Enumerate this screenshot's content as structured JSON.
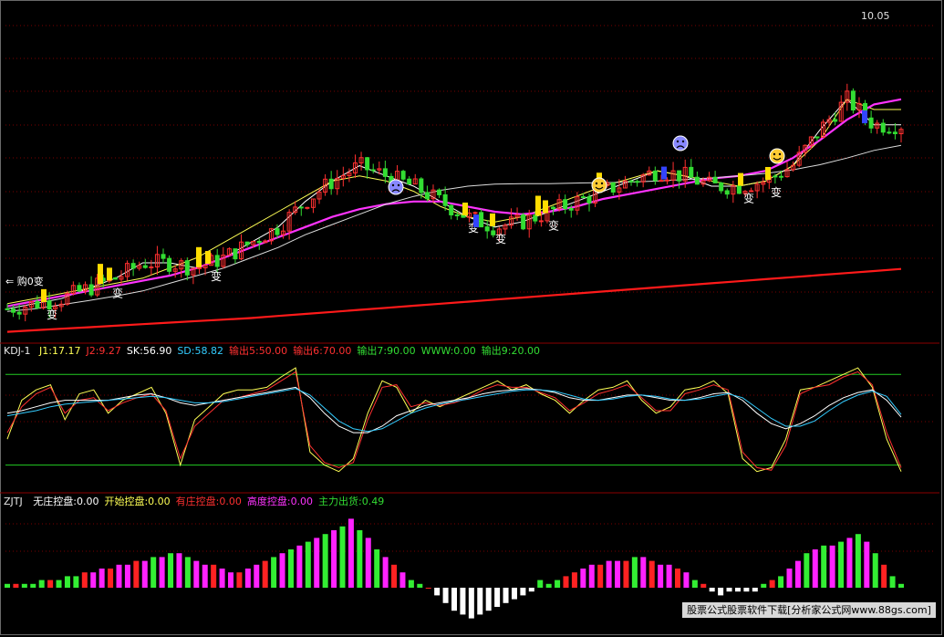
{
  "colors": {
    "background": "#000000",
    "grid": "#7a0000",
    "up_candle": "#ff3030",
    "down_candle": "#33dd33",
    "ma_fast": "#ffffff",
    "ma_mid": "#ffff55",
    "ma_magenta": "#ff33ff",
    "ma_slow": "#dddddd",
    "ma_red": "#ff1a1a",
    "kdj_j1": "#ffff55",
    "kdj_j2": "#ff3030",
    "kdj_sk": "#ffffff",
    "kdj_sd": "#33ccff",
    "bar_green": "#33ee33",
    "bar_red": "#ff2222",
    "bar_magenta": "#ff22ff",
    "bar_white": "#ffffff",
    "green_line": "#22cc22"
  },
  "price_panel": {
    "high_marker": "10.05",
    "signal_text": "变",
    "left_marker": "⇐ 购0变",
    "smiley_icons": [
      "happy-face-icon",
      "sad-face-icon"
    ]
  },
  "kdj_panel": {
    "title": "KDJ-1",
    "items": [
      {
        "label": "J1:",
        "value": "17.17",
        "color": "#ffff55"
      },
      {
        "label": "J2:",
        "value": "9.27",
        "color": "#ff3030"
      },
      {
        "label": "SK:",
        "value": "56.90",
        "color": "#ffffff"
      },
      {
        "label": "SD:",
        "value": "58.82",
        "color": "#33ccff"
      },
      {
        "label": "输出5:",
        "value": "50.00",
        "color": "#ff3030"
      },
      {
        "label": "输出6:",
        "value": "70.00",
        "color": "#ff3030"
      },
      {
        "label": "输出7:",
        "value": "90.00",
        "color": "#33dd33"
      },
      {
        "label": "WWW:",
        "value": "0.00",
        "color": "#33dd33"
      },
      {
        "label": "输出9:",
        "value": "20.00",
        "color": "#33dd33"
      }
    ]
  },
  "zjtj_panel": {
    "title": "ZJTJ",
    "items": [
      {
        "label": "无庄控盘:",
        "value": "0.00",
        "color": "#ffffff"
      },
      {
        "label": "开始控盘:",
        "value": "0.00",
        "color": "#ffff55"
      },
      {
        "label": "有庄控盘:",
        "value": "0.00",
        "color": "#ff3030"
      },
      {
        "label": "高度控盘:",
        "value": "0.00",
        "color": "#ff33ff"
      },
      {
        "label": "主力出货:",
        "value": "0.49",
        "color": "#33dd33"
      }
    ]
  },
  "footer": {
    "banner": "股票公式股票软件下载[分析家公式网www.88gs.com]"
  },
  "chart_data": [
    {
      "type": "candlestick",
      "title": "",
      "ylim": [
        3.8,
        10.3
      ],
      "ma_series": [
        {
          "values": [
            4.4,
            4.5,
            4.6,
            4.8,
            5.0,
            5.3,
            5.3,
            5.2,
            5.4,
            5.7,
            6.0,
            6.5,
            6.9,
            7.2,
            7.0,
            6.8,
            6.5,
            6.2,
            6.0,
            6.1,
            6.3,
            6.5,
            6.7,
            6.9,
            7.1,
            7.0,
            6.8,
            6.8,
            6.9,
            7.2,
            7.9,
            8.5,
            8.0,
            8.0
          ]
        },
        {
          "values": [
            4.5,
            4.6,
            4.7,
            4.8,
            4.9,
            5.0,
            5.2,
            5.4,
            5.7,
            6.0,
            6.3,
            6.6,
            6.9,
            7.0,
            6.9,
            6.7,
            6.4,
            6.2,
            6.1,
            6.2,
            6.4,
            6.6,
            6.8,
            6.95,
            7.1,
            7.0,
            6.9,
            6.8,
            6.9,
            7.2,
            7.7,
            8.5,
            8.3,
            8.3
          ]
        },
        {
          "values": [
            4.45,
            4.55,
            4.65,
            4.75,
            4.85,
            4.95,
            5.05,
            5.2,
            5.4,
            5.6,
            5.8,
            6.0,
            6.2,
            6.35,
            6.45,
            6.5,
            6.5,
            6.4,
            6.3,
            6.25,
            6.3,
            6.4,
            6.55,
            6.65,
            6.75,
            6.85,
            6.95,
            7.0,
            7.1,
            7.35,
            7.7,
            8.1,
            8.4,
            8.5
          ]
        },
        {
          "values": [
            4.35,
            4.4,
            4.48,
            4.56,
            4.65,
            4.75,
            4.9,
            5.05,
            5.2,
            5.4,
            5.6,
            5.85,
            6.05,
            6.25,
            6.45,
            6.6,
            6.72,
            6.8,
            6.84,
            6.85,
            6.85,
            6.86,
            6.87,
            6.88,
            6.9,
            6.93,
            6.96,
            7.0,
            7.05,
            7.12,
            7.22,
            7.35,
            7.5,
            7.6
          ]
        },
        {
          "values": [
            3.95,
            3.98,
            4.01,
            4.04,
            4.07,
            4.1,
            4.13,
            4.16,
            4.19,
            4.22,
            4.26,
            4.3,
            4.34,
            4.38,
            4.42,
            4.46,
            4.5,
            4.54,
            4.58,
            4.62,
            4.66,
            4.7,
            4.74,
            4.78,
            4.82,
            4.86,
            4.9,
            4.94,
            4.98,
            5.02,
            5.06,
            5.1,
            5.14,
            5.18
          ]
        }
      ]
    },
    {
      "type": "line",
      "title": "KDJ-1",
      "ylim": [
        0,
        100
      ],
      "series": [
        {
          "name": "J1",
          "values": [
            40,
            70,
            78,
            82,
            55,
            75,
            78,
            60,
            70,
            75,
            80,
            60,
            20,
            55,
            65,
            75,
            78,
            78,
            80,
            88,
            95,
            30,
            20,
            15,
            25,
            60,
            85,
            80,
            60,
            70,
            65,
            70,
            75,
            80,
            85,
            78,
            82,
            75,
            70,
            60,
            70,
            78,
            80,
            85,
            70,
            60,
            65,
            78,
            80,
            85,
            75,
            25,
            15,
            18,
            40,
            78,
            80,
            85,
            90,
            95,
            80,
            40,
            15
          ]
        },
        {
          "name": "J2",
          "values": [
            45,
            65,
            75,
            80,
            60,
            70,
            72,
            62,
            68,
            72,
            75,
            62,
            25,
            50,
            60,
            70,
            72,
            75,
            78,
            85,
            92,
            35,
            22,
            18,
            22,
            55,
            80,
            82,
            65,
            68,
            66,
            68,
            72,
            78,
            82,
            80,
            80,
            76,
            72,
            62,
            68,
            75,
            78,
            82,
            72,
            62,
            62,
            75,
            78,
            82,
            78,
            30,
            18,
            16,
            35,
            75,
            80,
            82,
            88,
            92,
            82,
            45,
            18
          ]
        },
        {
          "name": "SK",
          "values": [
            60,
            62,
            65,
            68,
            70,
            70,
            70,
            70,
            72,
            74,
            75,
            72,
            68,
            66,
            68,
            70,
            72,
            74,
            76,
            78,
            80,
            72,
            60,
            50,
            45,
            45,
            50,
            58,
            62,
            66,
            68,
            70,
            72,
            75,
            77,
            78,
            79,
            78,
            76,
            72,
            70,
            70,
            72,
            74,
            74,
            72,
            70,
            70,
            72,
            75,
            76,
            70,
            60,
            52,
            48,
            52,
            58,
            66,
            72,
            76,
            78,
            70,
            57
          ]
        },
        {
          "name": "SD",
          "values": [
            58,
            60,
            62,
            65,
            67,
            68,
            69,
            70,
            71,
            72,
            73,
            72,
            70,
            68,
            68,
            69,
            71,
            73,
            75,
            77,
            79,
            74,
            64,
            54,
            48,
            46,
            48,
            54,
            60,
            64,
            67,
            69,
            71,
            73,
            75,
            77,
            78,
            78,
            77,
            74,
            71,
            70,
            71,
            73,
            74,
            73,
            71,
            70,
            71,
            73,
            75,
            72,
            64,
            56,
            50,
            50,
            54,
            62,
            69,
            74,
            77,
            73,
            59
          ]
        }
      ],
      "reference_lines": [
        90,
        20
      ]
    },
    {
      "type": "bar",
      "title": "ZJTJ",
      "series": [
        {
          "name": "主力出货",
          "values": [
            1,
            1,
            1,
            1,
            2,
            2,
            2,
            3,
            3,
            4,
            4,
            5,
            5,
            6,
            6,
            7,
            7,
            8,
            8,
            9,
            9,
            8,
            7,
            6,
            6,
            5,
            4,
            4,
            5,
            6,
            7,
            8,
            9,
            10,
            11,
            12,
            13,
            14,
            15,
            16,
            18,
            15,
            13,
            10,
            8,
            6,
            4,
            2,
            1,
            0,
            -2,
            -4,
            -6,
            -7,
            -8,
            -7,
            -6,
            -5,
            -4,
            -3,
            -2,
            -1,
            2,
            1,
            2,
            3,
            4,
            5,
            6,
            6,
            7,
            7,
            7,
            8,
            8,
            7,
            6,
            6,
            5,
            4,
            2,
            1,
            -1,
            -2,
            -1,
            -1,
            -1,
            -1,
            1,
            2,
            3,
            5,
            7,
            9,
            10,
            11,
            11,
            12,
            13,
            14,
            12,
            9,
            6,
            3,
            1
          ]
        }
      ]
    }
  ]
}
